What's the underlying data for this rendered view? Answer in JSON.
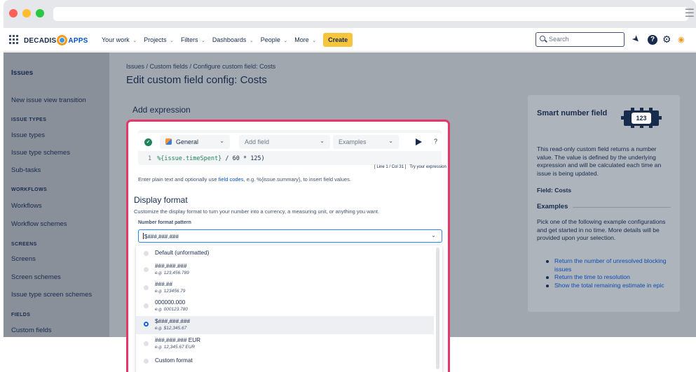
{
  "browser": {
    "menu_icon": "hamburger-icon"
  },
  "topnav": {
    "logo_left": "DECADIS",
    "logo_right": "APPS",
    "items": [
      {
        "label": "Your work"
      },
      {
        "label": "Projects"
      },
      {
        "label": "Filters"
      },
      {
        "label": "Dashboards"
      },
      {
        "label": "People"
      },
      {
        "label": "More"
      }
    ],
    "create_label": "Create",
    "search_placeholder": "Search"
  },
  "sidebar": {
    "title": "Issues",
    "new_issue_view": "New issue view transition",
    "issue_types_heading": "ISSUE TYPES",
    "issue_types": "Issue types",
    "issue_type_schemes": "Issue type schemes",
    "sub_tasks": "Sub-tasks",
    "workflows_heading": "WORKFLOWS",
    "workflows": "Workflows",
    "workflow_schemes": "Workflow schemes",
    "screens_heading": "SCREENS",
    "screens": "Screens",
    "screen_schemes": "Screen schemes",
    "issue_type_screen_schemes": "Issue type screen schemes",
    "fields_heading": "FIELDS",
    "custom_fields": "Custom fields"
  },
  "main": {
    "breadcrumb": "Issues  /  Custom fields  /  Configure custom field: Costs",
    "title": "Edit custom field config: Costs",
    "section_title": "Add expression"
  },
  "editor": {
    "general_label": "General",
    "add_field_label": "Add field",
    "examples_label": "Examples",
    "help_label": "?",
    "line_number": "1",
    "expr_fn": "%{issue.timeSpent}",
    "expr_rest": " / 60 * 125)",
    "line_info": "[ Line 1 / Col 31 ]",
    "try_label": "Try your expression",
    "hint_before": "Enter plain text and optionally use ",
    "hint_link": "field codes",
    "hint_after": ", e.g. %{issue.summary}, to insert field values."
  },
  "display_format": {
    "title": "Display format",
    "description": "Customize the display format to turn your number into a currency, a measuring unit, or anything you want.",
    "pattern_label": "Number format pattern",
    "pattern_value": "$###,###.###",
    "options": [
      {
        "label": "Default (unformatted)",
        "example": ""
      },
      {
        "label": "###,###.###",
        "example": "e.g. 123,456.789"
      },
      {
        "label": "###.##",
        "example": "e.g. 123456.79"
      },
      {
        "label": "000000.000",
        "example": "e.g. 000123.780"
      },
      {
        "label": "$###,###.###",
        "example": "e.g. $12,345.67"
      },
      {
        "label": "###,###.### EUR",
        "example": "e.g. 12,345.67 EUR"
      },
      {
        "label": "Custom format",
        "example": ""
      }
    ],
    "selected_index": 4
  },
  "info_panel": {
    "title": "Smart number field",
    "badge_text": "123",
    "description": "This read-only custom field returns a number value. The value is defined by the underlying expression and will be calculated each time an issue is being updated.",
    "field": "Field: Costs",
    "examples_heading": "Examples",
    "examples_desc": "Pick one of the following example configurations and get started in no time. More details will be provided upon your selection.",
    "links": [
      "Return the number of unresolved blocking issues",
      "Return the time to resolution",
      "Show the total remaining estimate in epic"
    ]
  },
  "colors": {
    "highlight_border": "#e8366a",
    "create_button": "#f7c53d",
    "link": "#0b4db3",
    "overlay": "#a1a7ae"
  }
}
